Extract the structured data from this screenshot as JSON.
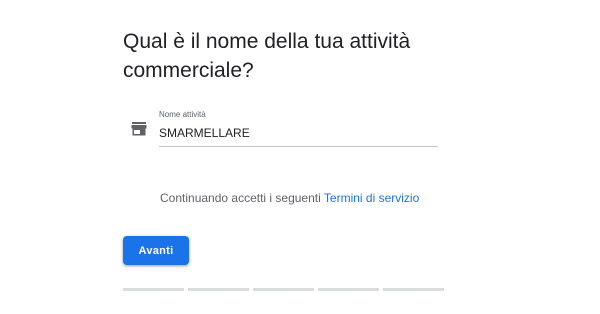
{
  "heading": {
    "title": "Qual è il nome della tua attività commerciale?"
  },
  "business_name_field": {
    "label": "Nome attività",
    "value": "SMARMELLARE",
    "icon": "storefront-icon"
  },
  "terms": {
    "text": "Continuando accetti i seguenti ",
    "link_text": "Termini di servizio"
  },
  "actions": {
    "next_label": "Avanti"
  },
  "progress": {
    "steps_total": 5,
    "steps_completed": 0
  },
  "colors": {
    "accent": "#1a73e8",
    "text_primary": "#202124",
    "text_secondary": "#5f6368",
    "divider": "#c6c6c6",
    "progress_track": "#dadce0"
  }
}
